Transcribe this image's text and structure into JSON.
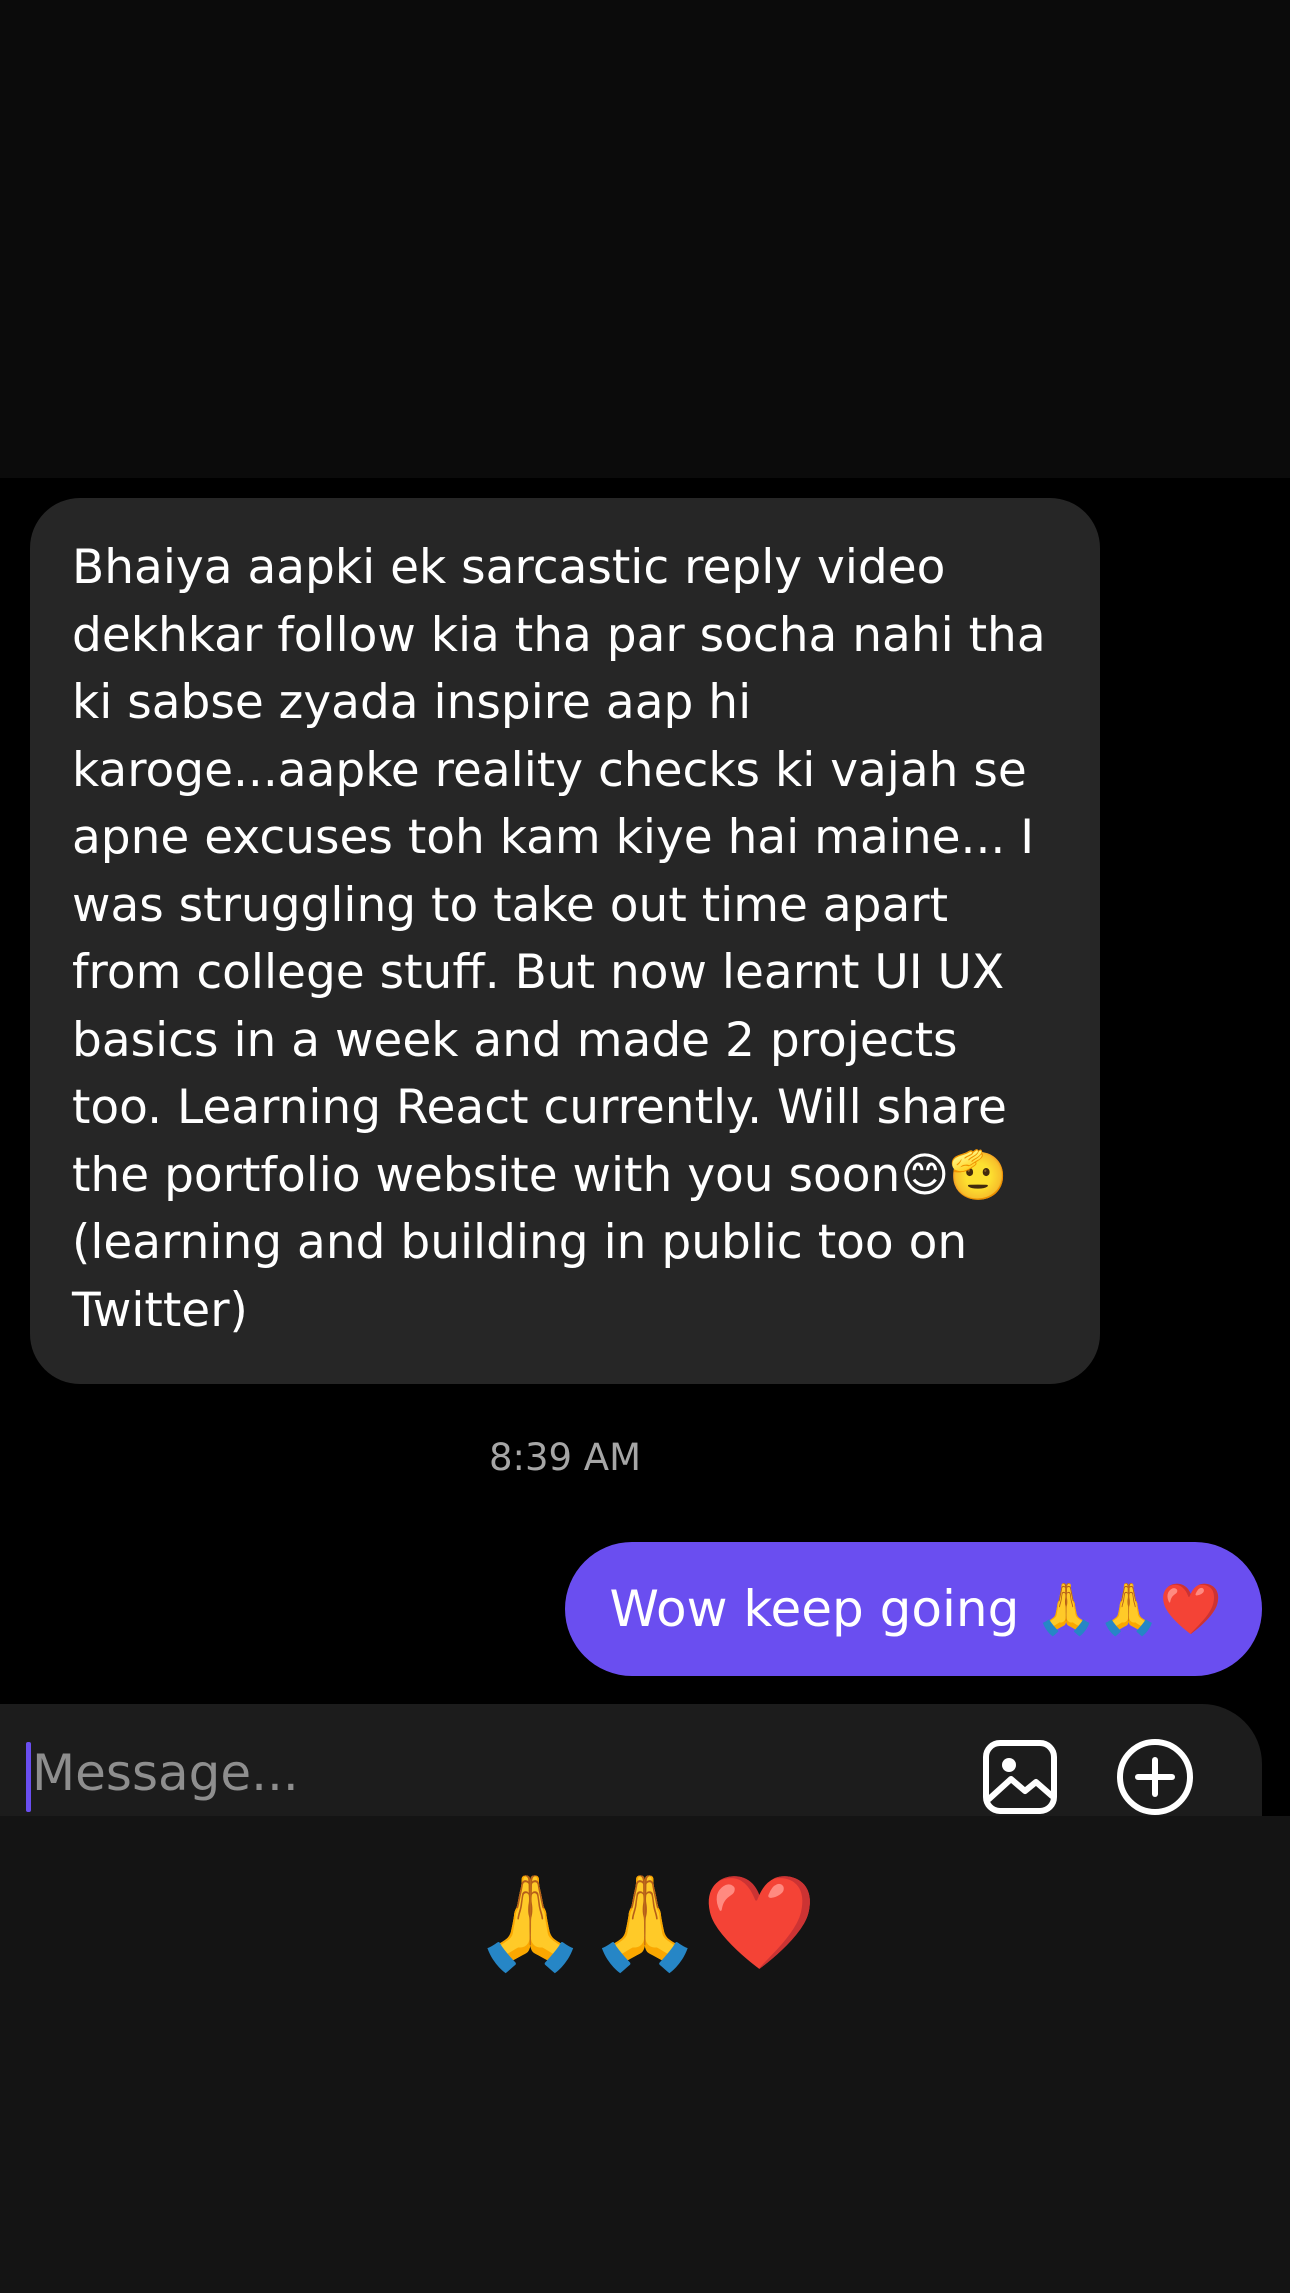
{
  "conversation": {
    "incoming_message": "Bhaiya aapki ek sarcastic reply video dekhkar follow kia tha par socha nahi tha ki sabse zyada inspire aap hi karoge...aapke reality checks ki vajah se apne excuses toh kam kiye hai maine... I was struggling to take out time apart from college stuff. But now learnt UI UX basics in a week and made 2 projects too. Learning React currently. Will share the portfolio website with you soon😊🫡(learning and building in public too on Twitter)",
    "timestamp": "8:39 AM",
    "outgoing_message": "Wow keep going 🙏🙏❤️"
  },
  "composer": {
    "placeholder": "Message...",
    "value": "",
    "photo_icon": "photo-icon",
    "add_icon": "plus-circle-icon"
  },
  "keyboard": {
    "suggestion": "🙏🙏❤️"
  },
  "colors": {
    "incoming_bubble": "#262626",
    "outgoing_bubble": "#6a4ef0",
    "background": "#000000"
  }
}
